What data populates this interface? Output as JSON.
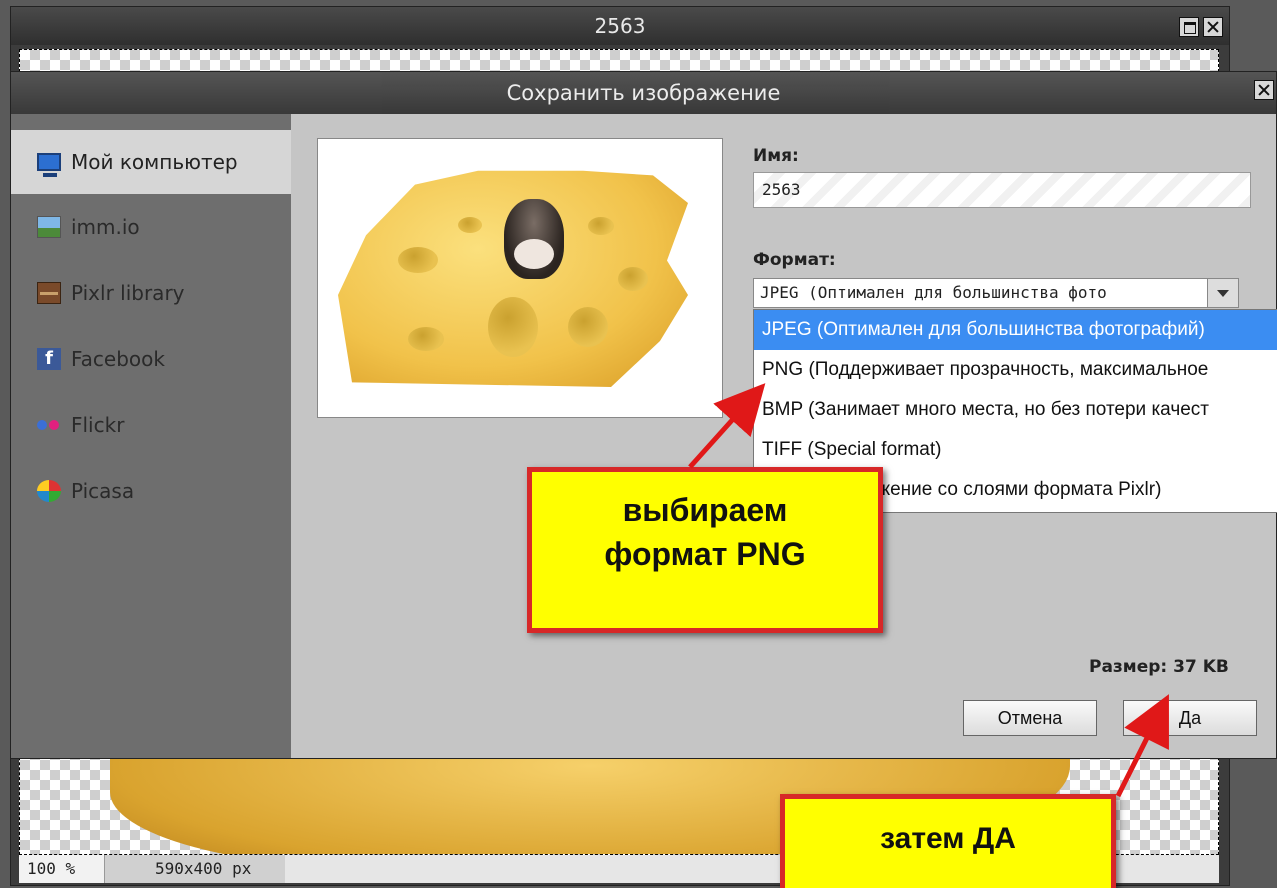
{
  "bg_window": {
    "title": "2563",
    "zoom": "100 %",
    "dimensions": "590x400 px"
  },
  "dialog": {
    "title": "Сохранить изображение",
    "sidebar": [
      {
        "label": "Мой компьютер",
        "icon": "computer-icon",
        "active": true
      },
      {
        "label": "imm.io",
        "icon": "image-icon",
        "active": false
      },
      {
        "label": "Pixlr library",
        "icon": "library-icon",
        "active": false
      },
      {
        "label": "Facebook",
        "icon": "facebook-icon",
        "active": false
      },
      {
        "label": "Flickr",
        "icon": "flickr-icon",
        "active": false
      },
      {
        "label": "Picasa",
        "icon": "picasa-icon",
        "active": false
      }
    ],
    "name_label": "Имя:",
    "name_value": "2563",
    "format_label": "Формат:",
    "format_selected": "JPEG (Оптимален для большинства фото",
    "format_options": [
      "JPEG (Оптимален для большинства фотографий)",
      "PNG (Поддерживает прозрачность, максимальное",
      "BMP (Занимает много места, но без потери качест",
      "TIFF (Special format)",
      "PXD (Изображение со слоями формата Pixlr)"
    ],
    "size_label": "Размер: 37 KB",
    "cancel_label": "Отмена",
    "ok_label": "Да"
  },
  "annotations": {
    "callout1_line1": "выбираем",
    "callout1_line2": "формат PNG",
    "callout2": "затем ДА",
    "arrow_color": "#e01818",
    "callout_bg": "#ffff00"
  },
  "colors": {
    "selected_option": "#3b8df2",
    "sidebar_bg": "#6e6e6e",
    "dialog_bg": "#c5c5c5"
  }
}
